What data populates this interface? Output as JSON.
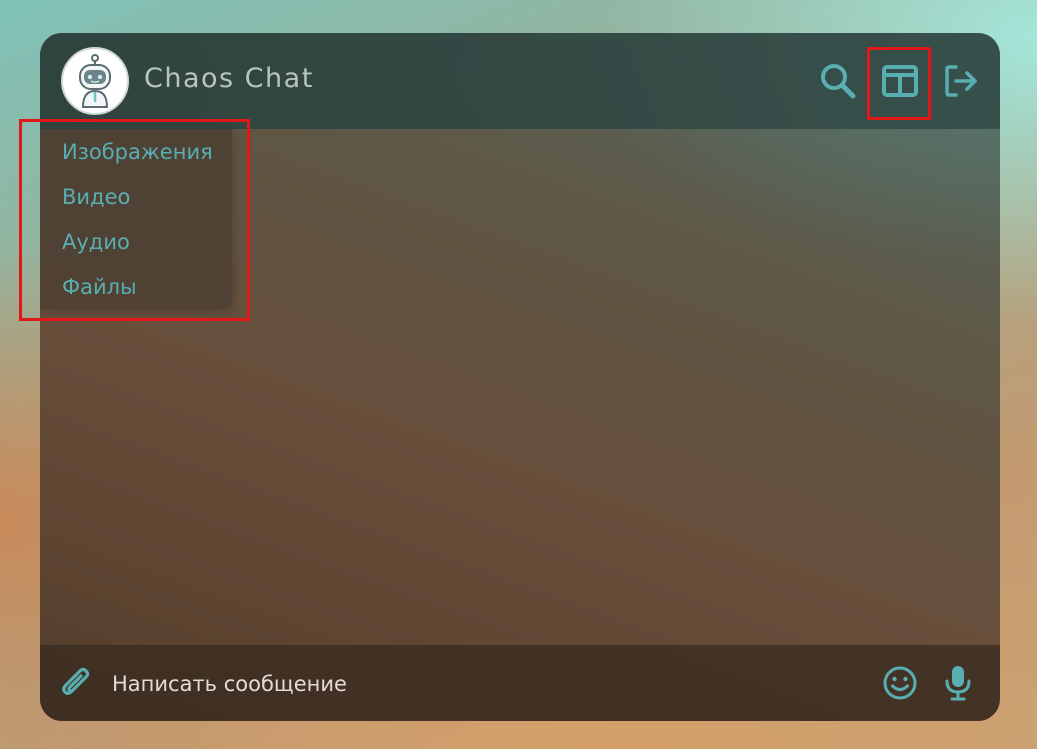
{
  "app": {
    "title": "Chaos Chat"
  },
  "colors": {
    "accent": "#59aeb2",
    "highlight": "#e01818"
  },
  "header": {
    "icons": [
      "robot-avatar-icon",
      "search-icon",
      "layout-panel-icon",
      "logout-icon"
    ]
  },
  "media_menu": {
    "items": [
      {
        "label": "Изображения"
      },
      {
        "label": "Видео"
      },
      {
        "label": "Аудио"
      },
      {
        "label": "Файлы"
      }
    ]
  },
  "composer": {
    "placeholder": "Написать сообщение",
    "icons": [
      "paperclip-icon",
      "smile-icon",
      "microphone-icon"
    ]
  }
}
